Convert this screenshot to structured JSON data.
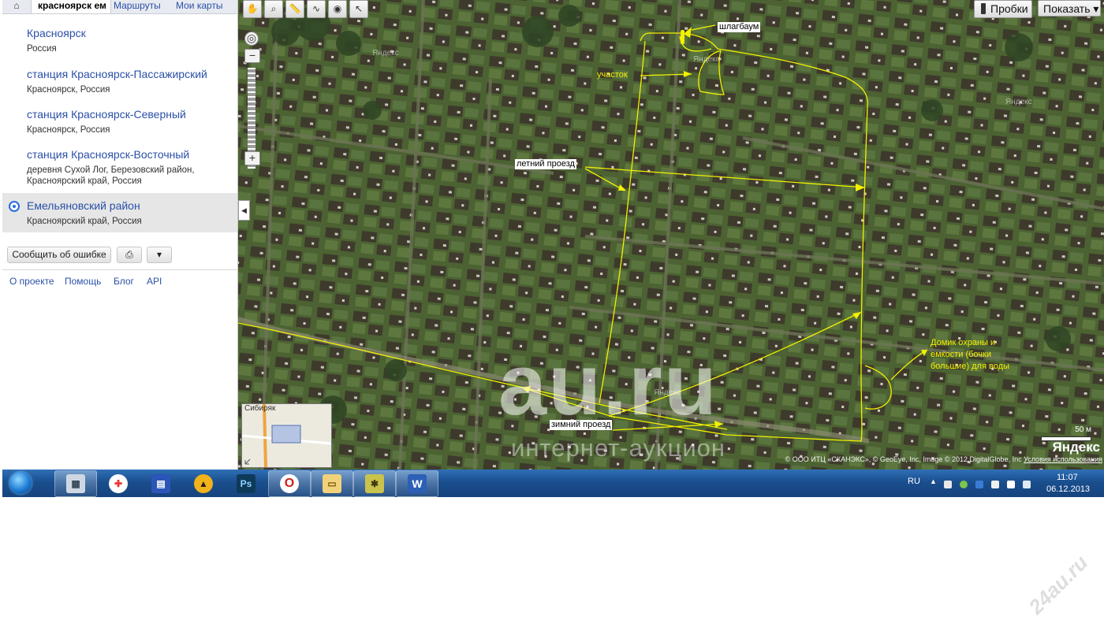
{
  "tabs": {
    "home_icon": "home-icon",
    "active": "красноярск ем",
    "routes": "Маршруты",
    "mymaps": "Мои карты"
  },
  "results": [
    {
      "title": "Красноярск",
      "subtitle": "Россия"
    },
    {
      "title": "станция Красноярск-Пассажирский",
      "subtitle": "Красноярск, Россия"
    },
    {
      "title": "станция Красноярск-Северный",
      "subtitle": "Красноярск, Россия"
    },
    {
      "title": "станция Красноярск-Восточный",
      "subtitle_lines": [
        "деревня Сухой Лог, Березовский район,",
        "Красноярский край, Россия"
      ]
    },
    {
      "title": "Емельяновский район",
      "subtitle": "Красноярский край, Россия",
      "selected": true
    }
  ],
  "actions": {
    "report": "Сообщить об ошибке",
    "print_icon": "printer-icon",
    "pin_icon": "pin-icon"
  },
  "footer": {
    "about": "О проекте",
    "help": "Помощь",
    "blog": "Блог",
    "api": "API"
  },
  "map": {
    "tools": [
      "hand-icon",
      "zoom-icon",
      "ruler-icon",
      "route-icon",
      "marker-icon",
      "select-icon"
    ],
    "zoom": {
      "in": "+",
      "out": "−"
    },
    "traffic": "Пробки",
    "show": "Показать",
    "show_arrow": "▾",
    "labels": {
      "barrier": "шлагбаум",
      "plot": "участок",
      "summer": "летний проезд",
      "winter": "зимний проезд",
      "guard": [
        "Домик охраны и",
        "емкости (бочки",
        "большие) для воды"
      ]
    },
    "watermark": "au.ru",
    "watermark_sub": "интернет-аукцион",
    "yandex_small": "Яндекс",
    "scale": "50 м",
    "brand": "Яндекс",
    "copyright": "© ООО ИТЦ «СКАНЭКС», © GeoEye, Inc, Image © 2012 DigitalGlobe, Inc",
    "terms": "Условия использования",
    "minimap_label": "Сибиряк",
    "annotation_color": "#f3f000"
  },
  "taskbar": {
    "apps": [
      {
        "icon": "network-icon",
        "color": "#cfd8e2",
        "glyph": "▦"
      },
      {
        "icon": "first-aid-icon",
        "color": "#e33",
        "glyph": "✚"
      },
      {
        "icon": "floppy-icon",
        "color": "#2b56b8",
        "glyph": "▤"
      },
      {
        "icon": "archive-icon",
        "color": "#f2b21a",
        "glyph": "▲"
      },
      {
        "icon": "photoshop-icon",
        "color": "#0e3a5a",
        "glyph": "Ps"
      },
      {
        "icon": "opera-icon",
        "color": "#d21a1a",
        "glyph": "O"
      },
      {
        "icon": "folder-icon",
        "color": "#f1d27a",
        "glyph": "▭"
      },
      {
        "icon": "puzzle-icon",
        "color": "#c9c34b",
        "glyph": "✱"
      },
      {
        "icon": "word-icon",
        "color": "#2c5fb5",
        "glyph": "W"
      }
    ],
    "lang": "RU",
    "time": "11:07",
    "date": "06.12.2013"
  },
  "site_watermark": "24au.ru"
}
